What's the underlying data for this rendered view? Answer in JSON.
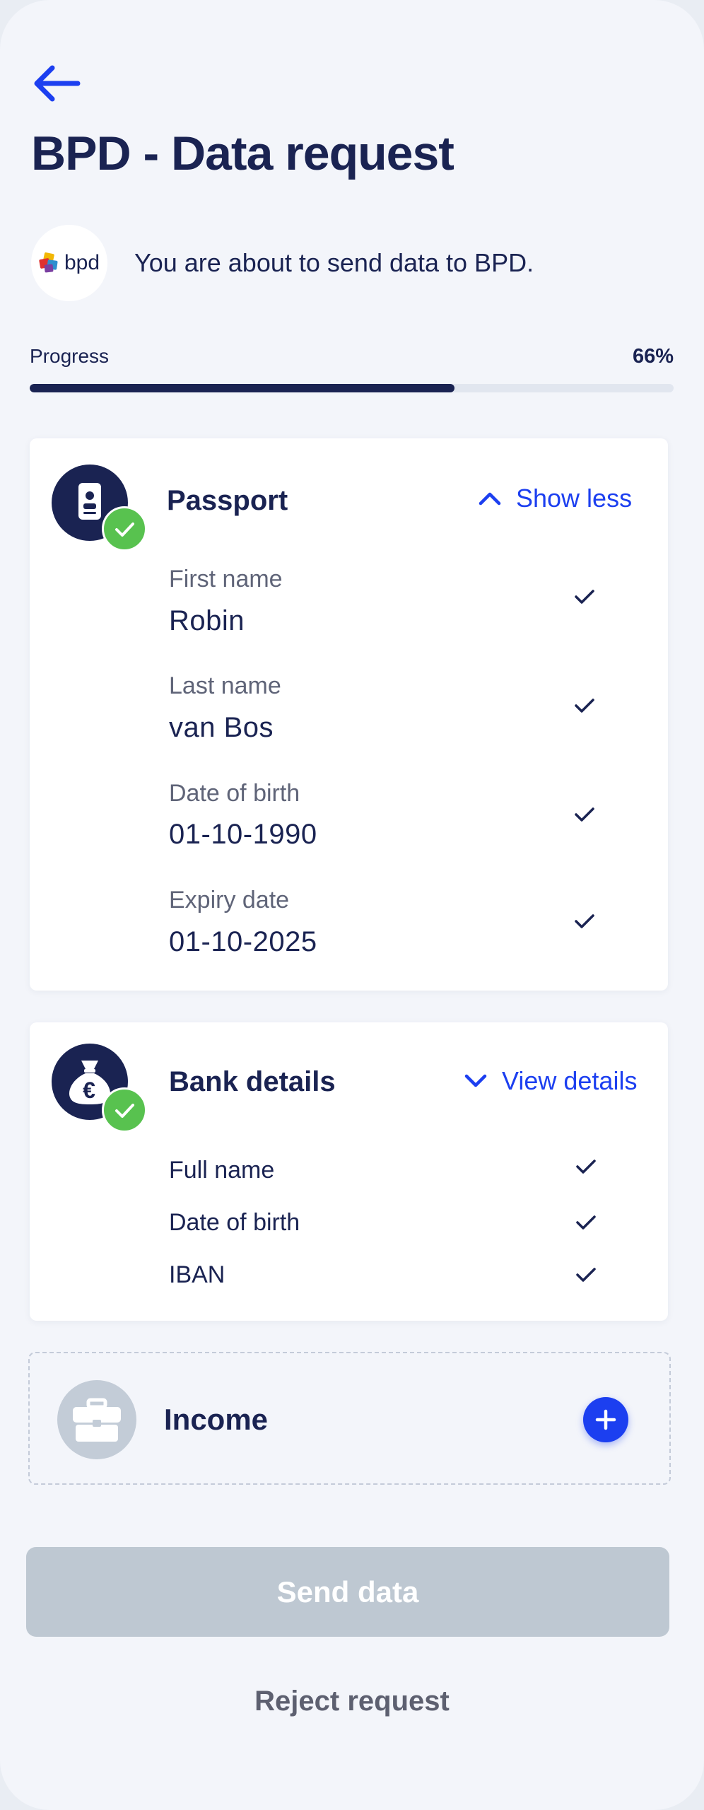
{
  "header": {
    "back_icon": "arrow-left-icon",
    "title": "BPD - Data request"
  },
  "requester": {
    "logo_text": "bpd",
    "message": "You are about to send data to BPD."
  },
  "progress": {
    "label": "Progress",
    "value_text": "66%",
    "fraction": 0.66
  },
  "passport": {
    "icon": "id-card-icon",
    "status_icon": "check-icon",
    "title": "Passport",
    "toggle_label": "Show less",
    "toggle_icon": "chevron-up-icon",
    "fields": [
      {
        "label": "First name",
        "value": "Robin"
      },
      {
        "label": "Last name",
        "value": "van Bos"
      },
      {
        "label": "Date of birth",
        "value": "01-10-1990"
      },
      {
        "label": "Expiry date",
        "value": "01-10-2025"
      }
    ]
  },
  "bank": {
    "icon": "money-bag-euro-icon",
    "status_icon": "check-icon",
    "title": "Bank details",
    "toggle_label": "View details",
    "toggle_icon": "chevron-down-icon",
    "items": [
      "Full name",
      "Date of birth",
      "IBAN"
    ]
  },
  "income": {
    "icon": "briefcase-icon",
    "title": "Income",
    "add_icon": "plus-icon"
  },
  "actions": {
    "send_label": "Send data",
    "reject_label": "Reject request"
  },
  "colors": {
    "accent": "#1c3ff0",
    "navy": "#1a2352",
    "success": "#58c24f",
    "disabled": "#bec8d2"
  }
}
